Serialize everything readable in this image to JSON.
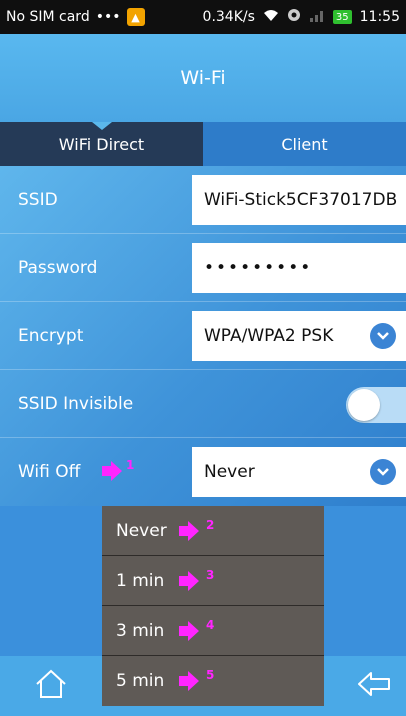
{
  "status_bar": {
    "carrier": "No SIM card",
    "dots": "•••",
    "speed": "0.34K/s",
    "battery": "35",
    "time": "11:55"
  },
  "header": {
    "title": "Wi-Fi"
  },
  "tabs": [
    {
      "label": "WiFi Direct",
      "active": true
    },
    {
      "label": "Client",
      "active": false
    }
  ],
  "form": {
    "ssid": {
      "label": "SSID",
      "value": "WiFi-Stick5CF37017DB"
    },
    "password": {
      "label": "Password",
      "value": "•••••••••"
    },
    "encrypt": {
      "label": "Encrypt",
      "value": "WPA/WPA2 PSK"
    },
    "ssid_invisible": {
      "label": "SSID Invisible",
      "on": false
    },
    "wifi_off": {
      "label": "Wifi Off",
      "value": "Never",
      "marker": "1"
    }
  },
  "dropdown": {
    "options": [
      {
        "label": "Never",
        "marker": "2"
      },
      {
        "label": "1 min",
        "marker": "3"
      },
      {
        "label": "3 min",
        "marker": "4"
      },
      {
        "label": "5 min",
        "marker": "5"
      }
    ]
  },
  "colors": {
    "annotation": "#ff25ff",
    "accent": "#3b84d4",
    "tab_active": "#253a57"
  },
  "icons": {
    "home": "home-icon",
    "back": "back-icon",
    "chevron": "chevron-down-icon"
  }
}
